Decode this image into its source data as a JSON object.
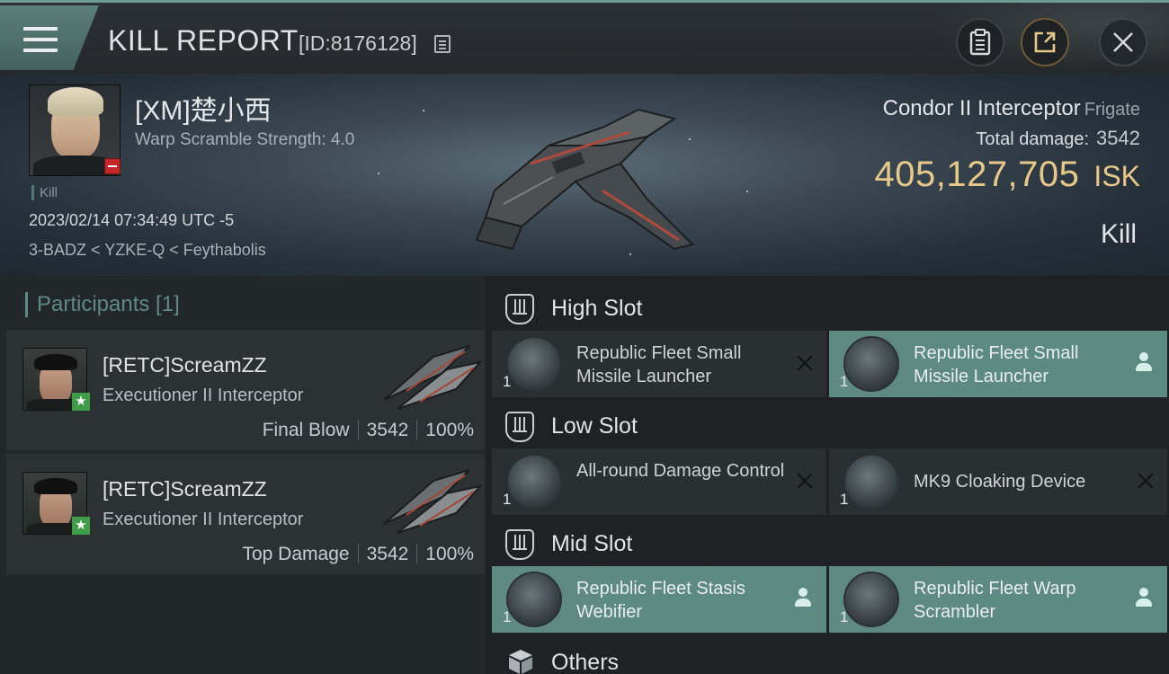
{
  "header": {
    "title": "KILL REPORT",
    "id_label": "[ID:8176128]"
  },
  "victim": {
    "name": "[XM]楚小西",
    "warp_scramble_strength": "Warp Scramble Strength: 4.0",
    "tag": "Kill",
    "datetime": "2023/02/14 07:34:49 UTC -5",
    "location": "3-BADZ < YZKE-Q < Feythabolis"
  },
  "ship": {
    "name": "Condor II Interceptor",
    "class": "Frigate",
    "total_damage_label": "Total damage:",
    "total_damage": "3542",
    "isk_value": "405,127,705",
    "isk_unit": "ISK",
    "result": "Kill"
  },
  "participants": {
    "title": "Participants [1]",
    "items": [
      {
        "name": "[RETC]ScreamZZ",
        "ship": "Executioner II Interceptor",
        "role": "Final Blow",
        "damage": "3542",
        "percent": "100%"
      },
      {
        "name": "[RETC]ScreamZZ",
        "ship": "Executioner II Interceptor",
        "role": "Top Damage",
        "damage": "3542",
        "percent": "100%"
      }
    ]
  },
  "fitting": {
    "high_slot": {
      "label": "High Slot",
      "modules": [
        {
          "name": "Republic Fleet Small Missile Launcher",
          "qty": "1",
          "status": "destroyed"
        },
        {
          "name": "Republic Fleet Small Missile Launcher",
          "qty": "1",
          "status": "dropped"
        }
      ]
    },
    "low_slot": {
      "label": "Low Slot",
      "modules": [
        {
          "name": "All-round Damage Control",
          "qty": "1",
          "status": "destroyed"
        },
        {
          "name": "MK9 Cloaking Device",
          "qty": "1",
          "status": "destroyed"
        }
      ]
    },
    "mid_slot": {
      "label": "Mid Slot",
      "modules": [
        {
          "name": "Republic Fleet Stasis Webifier",
          "qty": "1",
          "status": "dropped"
        },
        {
          "name": "Republic Fleet Warp Scrambler",
          "qty": "1",
          "status": "dropped"
        }
      ]
    },
    "others": {
      "label": "Others"
    }
  },
  "colors": {
    "accent_teal": "#5c8a82",
    "isk_gold": "#e6c98a",
    "badge_red": "#c4262a",
    "badge_green": "#3f9c48"
  },
  "icons": [
    "menu-icon",
    "copy-icon",
    "clipboard-icon",
    "share-icon",
    "close-icon",
    "slot-icon",
    "box-icon",
    "person-icon",
    "x-icon",
    "star-icon",
    "minus-icon"
  ]
}
